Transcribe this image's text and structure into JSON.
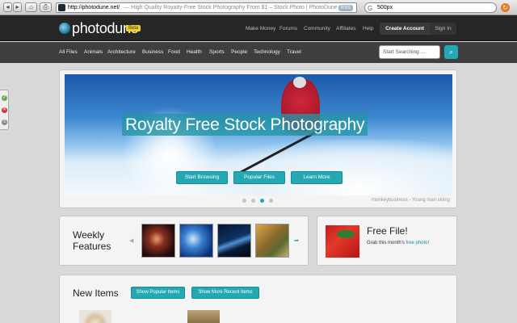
{
  "browser": {
    "back_icon": "back-arrow-icon",
    "forward_icon": "forward-arrow-icon",
    "url": "http://photodune.net/",
    "tab_title": "— High Quality Royalty-Free Stock Photography From $1 – Stock Photo | PhotoDune",
    "rss_label": "RSS",
    "search_query": "500px",
    "search_engine_glyph": "G"
  },
  "site": {
    "logo_text": "photodune",
    "beta_label": "Beta",
    "top_links": [
      "Make Money",
      "Forums",
      "Community",
      "Affiliates",
      "Help"
    ],
    "create_account": "Create Account",
    "sign_in": "Sign In",
    "categories": [
      "All Files",
      "Animals",
      "Architecture",
      "Business",
      "Food",
      "Health",
      "Sports",
      "People",
      "Technology",
      "Travel"
    ],
    "search_placeholder": "Start Searching ...",
    "accent_color": "#23a8b4"
  },
  "hero": {
    "title": "Royalty Free Stock Photography",
    "buttons": [
      "Start Browsing",
      "Popular Files",
      "Learn More"
    ],
    "caption": "monkeybusiness - Young man skiing",
    "slide_count": 4,
    "active_slide": 3
  },
  "weekly": {
    "title_line1": "Weekly",
    "title_line2": "Features",
    "prev_glyph": "◀",
    "next_glyph": "➡"
  },
  "free_file": {
    "title": "Free File!",
    "text_prefix": "Grab this month's ",
    "link_text": "free photo!"
  },
  "new_items": {
    "title": "New Items",
    "buttons": [
      "Show Popular Items",
      "Show More Recent Items"
    ]
  }
}
